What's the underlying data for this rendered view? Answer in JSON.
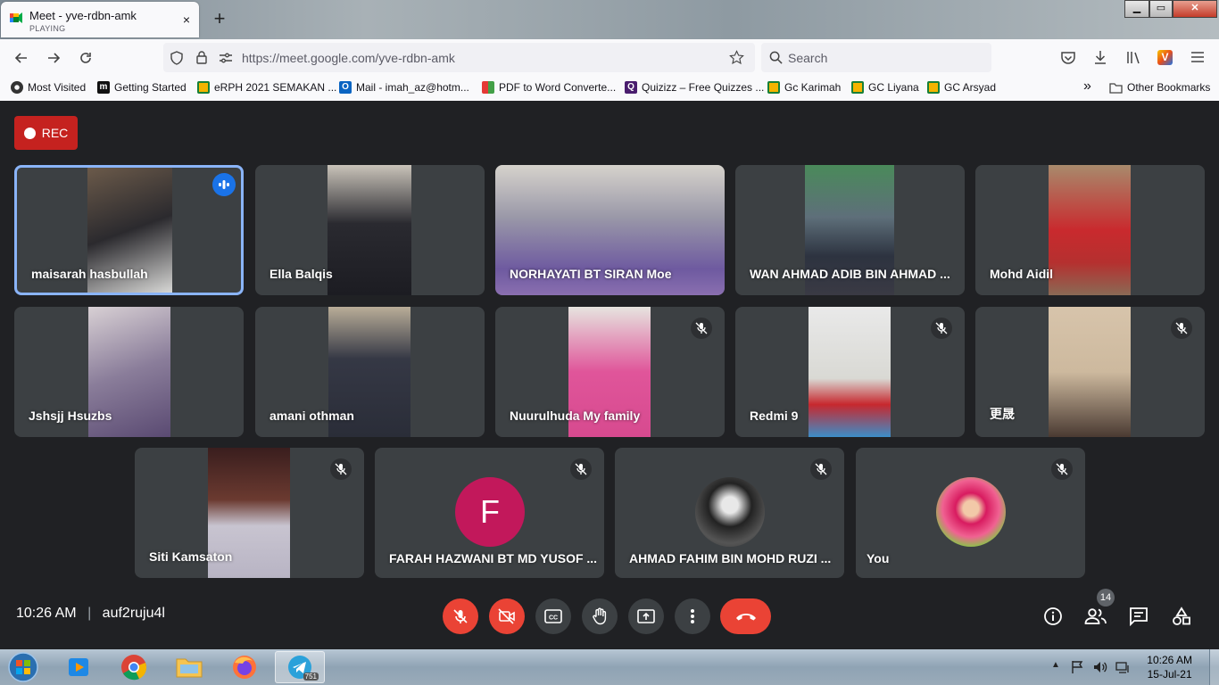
{
  "browser": {
    "tab": {
      "title": "Meet - yve-rdbn-amk",
      "status": "PLAYING",
      "close": "×"
    },
    "new_tab": "+",
    "url": "https://meet.google.com/yve-rdbn-amk",
    "search_placeholder": "Search",
    "bookmarks": [
      {
        "label": "Most Visited",
        "icon": "gear-icon"
      },
      {
        "label": "Getting Started",
        "icon": "m-icon"
      },
      {
        "label": "eRPH 2021 SEMAKAN ...",
        "icon": "classroom-icon"
      },
      {
        "label": "Mail - imah_az@hotm...",
        "icon": "outlook-icon"
      },
      {
        "label": "PDF to Word Converte...",
        "icon": "pdf-icon"
      },
      {
        "label": "Quizizz – Free Quizzes ...",
        "icon": "quizizz-icon"
      },
      {
        "label": "Gc Karimah",
        "icon": "classroom-icon"
      },
      {
        "label": "GC Liyana",
        "icon": "classroom-icon"
      },
      {
        "label": "GC Arsyad",
        "icon": "classroom-icon"
      }
    ],
    "other_bookmarks": "Other Bookmarks",
    "overflow": "»"
  },
  "meet": {
    "rec_label": "REC",
    "participants": [
      {
        "name": "maisarah hasbullah",
        "muted": false,
        "speaking": true
      },
      {
        "name": "Ella Balqis",
        "muted": false
      },
      {
        "name": "NORHAYATI BT SIRAN Moe",
        "muted": false
      },
      {
        "name": "WAN AHMAD ADIB BIN AHMAD ...",
        "muted": false
      },
      {
        "name": "Mohd Aidil",
        "muted": false
      },
      {
        "name": "Jshsjj Hsuzbs",
        "muted": false
      },
      {
        "name": "amani othman",
        "muted": false
      },
      {
        "name": "Nuurulhuda My family",
        "muted": true
      },
      {
        "name": "Redmi 9",
        "muted": true
      },
      {
        "name": "更晟",
        "muted": true
      },
      {
        "name": "Siti Kamsaton",
        "muted": true
      },
      {
        "name": "FARAH HAZWANI BT MD YUSOF ...",
        "muted": true,
        "avatar_letter": "F"
      },
      {
        "name": "AHMAD FAHIM BIN MOHD RUZI ...",
        "muted": true
      },
      {
        "name": "You",
        "muted": true
      }
    ],
    "time": "10:26 AM",
    "separator": "|",
    "meeting_code": "auf2ruju4l",
    "participant_count": "14"
  },
  "taskbar": {
    "time": "10:26 AM",
    "date": "15-Jul-21",
    "telegram_badge": "751"
  },
  "colors": {
    "rec": "#c5221f",
    "end_call": "#ea4335",
    "tile": "#3c4043",
    "bg": "#202124",
    "active": "#8ab4f8"
  }
}
